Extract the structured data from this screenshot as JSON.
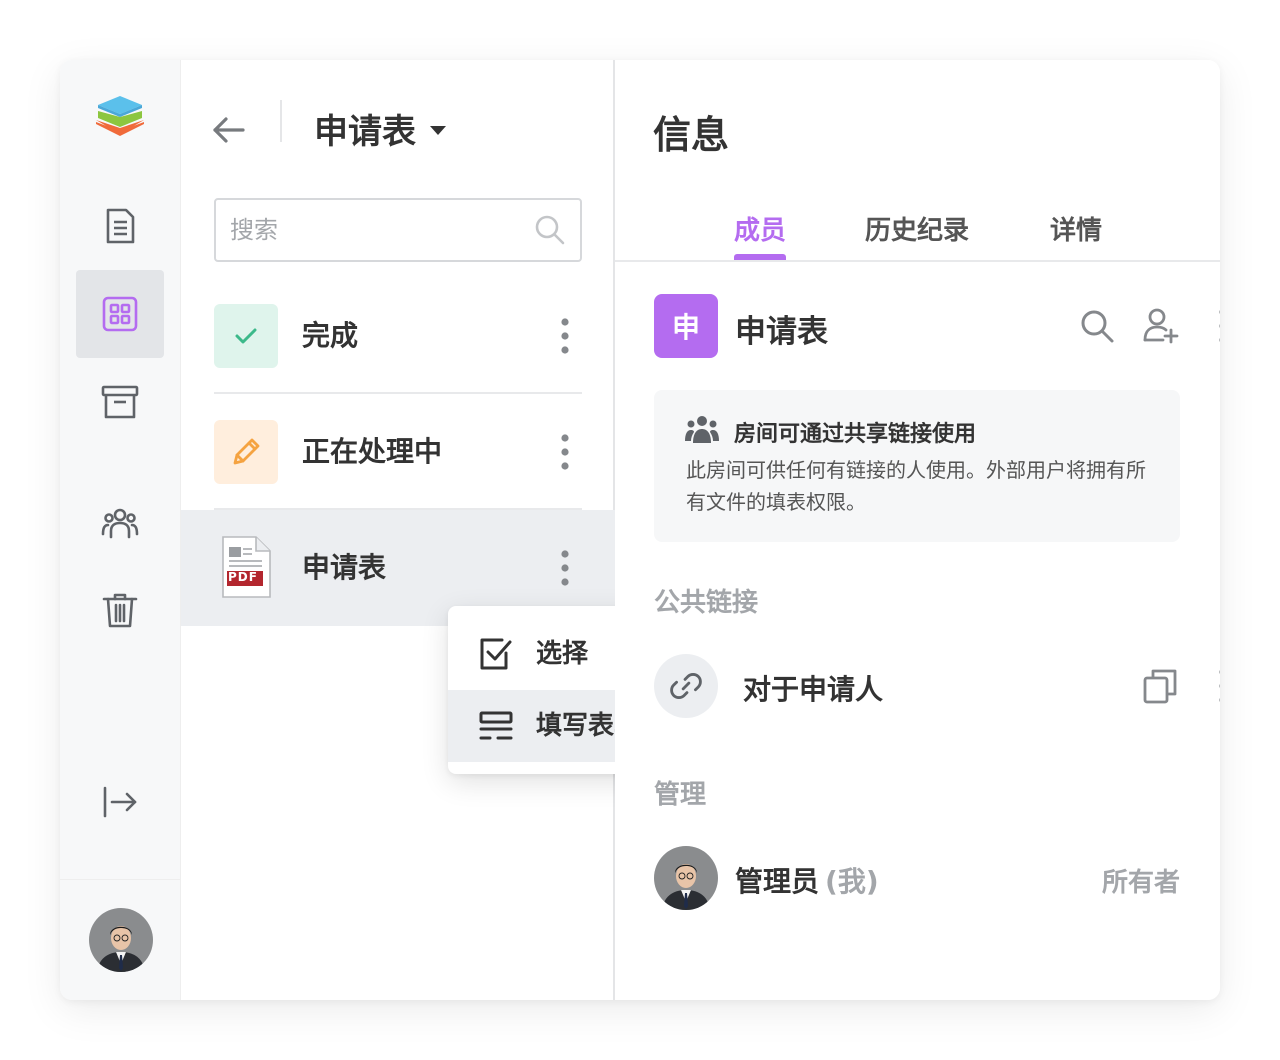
{
  "header": {
    "title": "申请表"
  },
  "search": {
    "placeholder": "搜索"
  },
  "files": [
    {
      "name": "完成",
      "icon": "check-icon"
    },
    {
      "name": "正在处理中",
      "icon": "pencil-icon"
    },
    {
      "name": "申请表",
      "icon": "pdf-file-icon",
      "pdf_label": "PDF"
    }
  ],
  "context_menu": {
    "items": [
      {
        "label": "选择",
        "icon": "checkbox-icon"
      },
      {
        "label": "填写表单",
        "icon": "form-fill-icon"
      }
    ]
  },
  "info": {
    "title": "信息",
    "tabs": [
      {
        "label": "成员",
        "active": true
      },
      {
        "label": "历史纪录"
      },
      {
        "label": "详情"
      }
    ],
    "room": {
      "initial": "申",
      "name": "申请表"
    },
    "notice": {
      "title": "房间可通过共享链接使用",
      "text": "此房间可供任何有链接的人使用。外部用户将拥有所有文件的填表权限。"
    },
    "public_links_heading": "公共链接",
    "link": {
      "name": "对于申请人"
    },
    "admin_heading": "管理",
    "member": {
      "name": "管理员",
      "me": "(我)",
      "role": "所有者"
    }
  },
  "colors": {
    "accent": "#b46cf0",
    "check_green": "#3cb98a",
    "pencil_orange": "#f5a341",
    "pdf_red": "#b3262e"
  }
}
